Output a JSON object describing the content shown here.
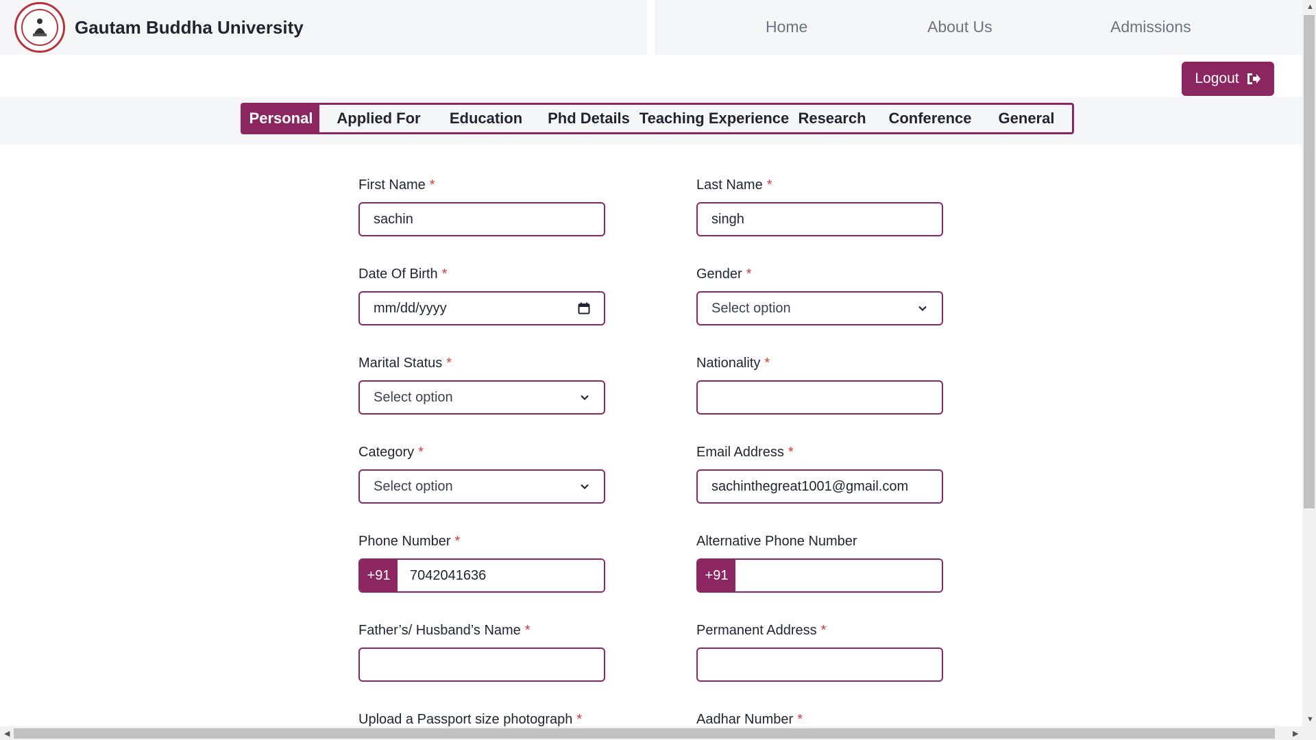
{
  "header": {
    "brand": "Gautam Buddha University",
    "nav": [
      "Home",
      "About Us",
      "Admissions"
    ]
  },
  "logout_label": "Logout",
  "tabs": [
    "Personal",
    "Applied For",
    "Education",
    "Phd Details",
    "Teaching Experience",
    "Research",
    "Conference",
    "General"
  ],
  "active_tab": "Personal",
  "required_mark": "*",
  "form": {
    "first_name": {
      "label": "First Name",
      "value": "sachin"
    },
    "last_name": {
      "label": "Last Name",
      "value": "singh"
    },
    "dob": {
      "label": "Date Of Birth",
      "placeholder": "mm/dd/yyyy"
    },
    "gender": {
      "label": "Gender",
      "selected": "Select option"
    },
    "marital_status": {
      "label": "Marital Status",
      "selected": "Select option"
    },
    "nationality": {
      "label": "Nationality",
      "value": ""
    },
    "category": {
      "label": "Category",
      "selected": "Select option"
    },
    "email": {
      "label": "Email Address",
      "value": "sachinthegreat1001@gmail.com"
    },
    "phone": {
      "label": "Phone Number",
      "code": "+91",
      "value": "7042041636"
    },
    "alt_phone": {
      "label": "Alternative Phone Number",
      "code": "+91",
      "value": ""
    },
    "father_name": {
      "label": "Father’s/ Husband’s Name",
      "value": ""
    },
    "permanent_address": {
      "label": "Permanent Address",
      "value": ""
    },
    "photo": {
      "label": "Upload a Passport size photograph"
    },
    "aadhar": {
      "label": "Aadhar Number"
    }
  },
  "colors": {
    "accent": "#8b2660",
    "required": "#d43a3a",
    "header_bg": "#f5f6f8"
  }
}
